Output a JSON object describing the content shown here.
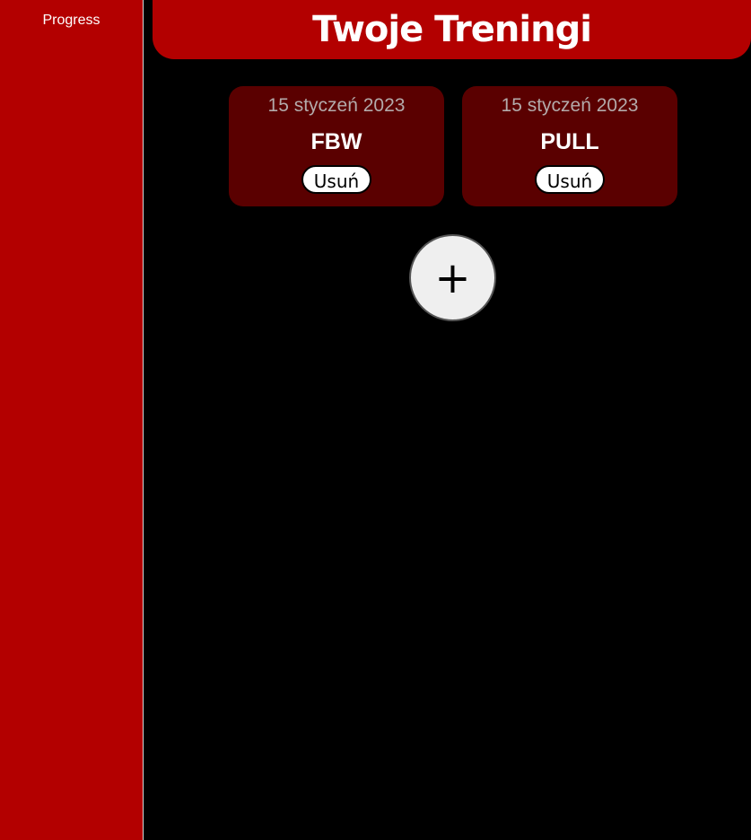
{
  "sidebar": {
    "items": [
      {
        "label": "Progress"
      }
    ]
  },
  "header": {
    "title": "Twoje Treningi"
  },
  "workouts": [
    {
      "date": "15 styczeń 2023",
      "name": "FBW",
      "delete_label": "Usuń"
    },
    {
      "date": "15 styczeń 2023",
      "name": "PULL",
      "delete_label": "Usuń"
    }
  ],
  "add_button": {
    "icon": "plus-icon",
    "label": "+"
  },
  "colors": {
    "accent": "#b30000",
    "card_bg": "#5a0000",
    "background": "#000000"
  }
}
